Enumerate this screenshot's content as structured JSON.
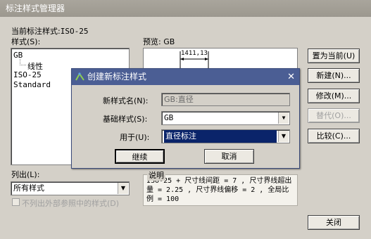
{
  "window": {
    "title": "标注样式管理器"
  },
  "current_style": {
    "label": "当前标注样式:",
    "value": "ISO-25"
  },
  "styles_list": {
    "label": "样式(S):",
    "items": [
      "GB",
      "线性",
      "ISO-25",
      "Standard"
    ]
  },
  "preview": {
    "label": "预览: GB",
    "dimension_text": "1411,13"
  },
  "buttons": {
    "set_current": "置为当前(U)",
    "new": "新建(N)...",
    "modify": "修改(M)...",
    "override": "替代(O)...",
    "compare": "比较(C)...",
    "close": "关闭"
  },
  "list_filter": {
    "label": "列出(L):",
    "value": "所有样式",
    "checkbox_label": "不列出外部参照中的样式(D)"
  },
  "description": {
    "label": "说明",
    "text": "ISO-25 + 尺寸线间距 = 7 , 尺寸界线超出量 = 2.25 , 尺寸界线偏移 = 2 , 全局比例 = 100"
  },
  "dialog": {
    "title": "创建新标注样式",
    "new_name_label": "新样式名(N):",
    "new_name_value": "GB:直径",
    "base_style_label": "基础样式(S):",
    "base_style_value": "GB",
    "use_for_label": "用于(U):",
    "use_for_value": "直径标注",
    "continue": "继续",
    "cancel": "取消",
    "close_glyph": "✕"
  },
  "colors": {
    "dialog_title_bar": "#4b5e94",
    "selection": "#0a246a"
  }
}
